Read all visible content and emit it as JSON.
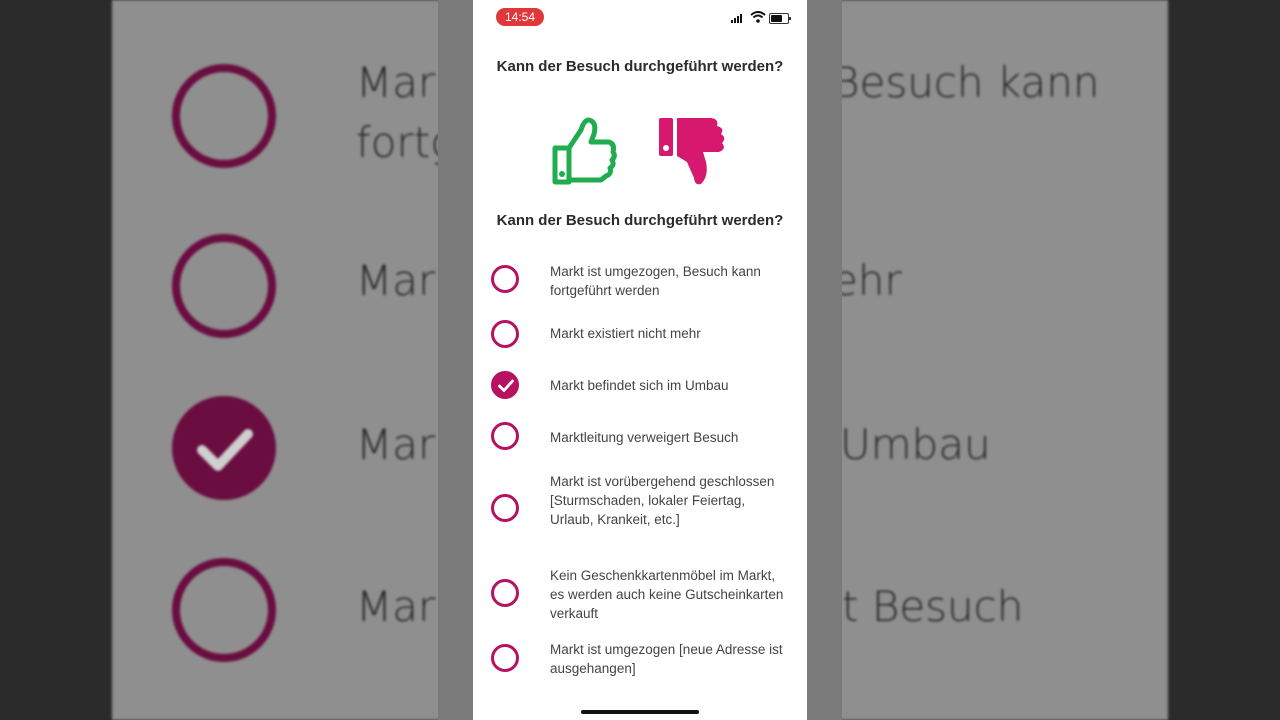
{
  "status_bar": {
    "time": "14:54"
  },
  "section1": {
    "title": "Kann der Besuch durchgeführt werden?"
  },
  "section2": {
    "title": "Kann der Besuch durchgeführt werden?"
  },
  "colors": {
    "accent": "#b5125f",
    "thumb_up": "#1fad4f",
    "thumb_down": "#d6186f"
  },
  "options": [
    {
      "label": "Markt ist umgezogen, Besuch kann fortgeführt werden",
      "checked": false
    },
    {
      "label": "Markt existiert nicht mehr",
      "checked": false
    },
    {
      "label": "Markt befindet sich im Umbau",
      "checked": true
    },
    {
      "label": "Marktleitung verweigert Besuch",
      "checked": false
    },
    {
      "label": "Markt ist vorübergehend geschlossen [Sturmschaden, lokaler Feiertag, Urlaub, Krankeit, etc.]",
      "checked": false
    },
    {
      "label": "Kein Geschenkkartenmöbel im Markt, es werden auch keine Gutscheinkarten verkauft",
      "checked": false
    },
    {
      "label": "Markt ist umgezogen [neue Adresse ist ausgehangen]",
      "checked": false
    }
  ],
  "background": {
    "texts": [
      "Mar",
      "fortg",
      "Besuch kann",
      "Mar",
      "ehr",
      "Mar",
      "Umbau",
      "Mar",
      "t Besuch"
    ]
  }
}
